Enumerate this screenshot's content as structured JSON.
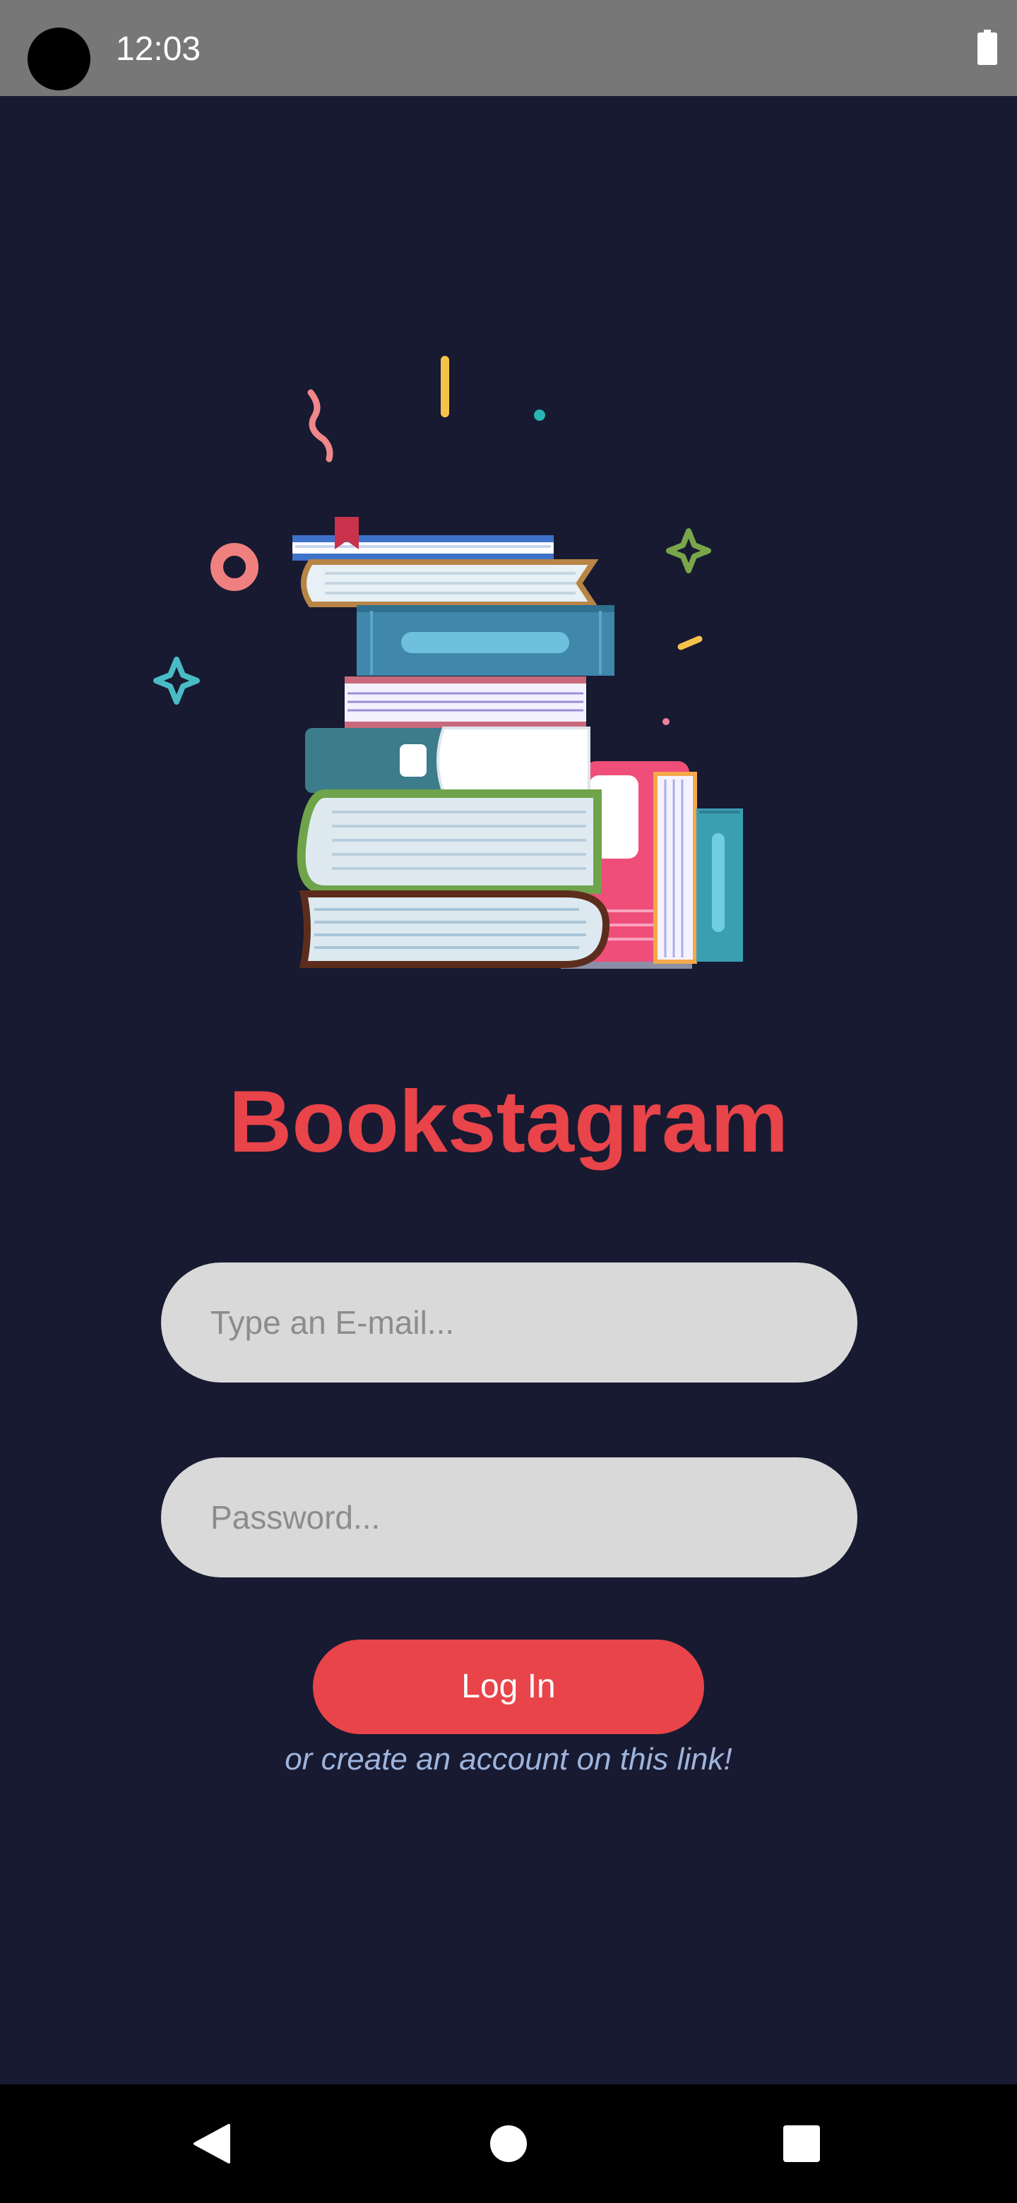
{
  "status_bar": {
    "time": "12:03",
    "battery_icon": "battery-full-icon"
  },
  "illustration": {
    "icon": "book-stack-illustration"
  },
  "app": {
    "title": "Bookstagram"
  },
  "login_form": {
    "email_placeholder": "Type an E-mail...",
    "password_placeholder": "Password...",
    "login_label": "Log In",
    "create_account_text": "or create an account on this link!"
  },
  "nav_bar": {
    "back_icon": "back-triangle-icon",
    "home_icon": "home-circle-icon",
    "recents_icon": "recents-square-icon"
  },
  "colors": {
    "background": "#171a31",
    "accent": "#e84449",
    "link": "#9fb4dc",
    "field": "#d9d9d9",
    "status_bar": "#777777"
  }
}
